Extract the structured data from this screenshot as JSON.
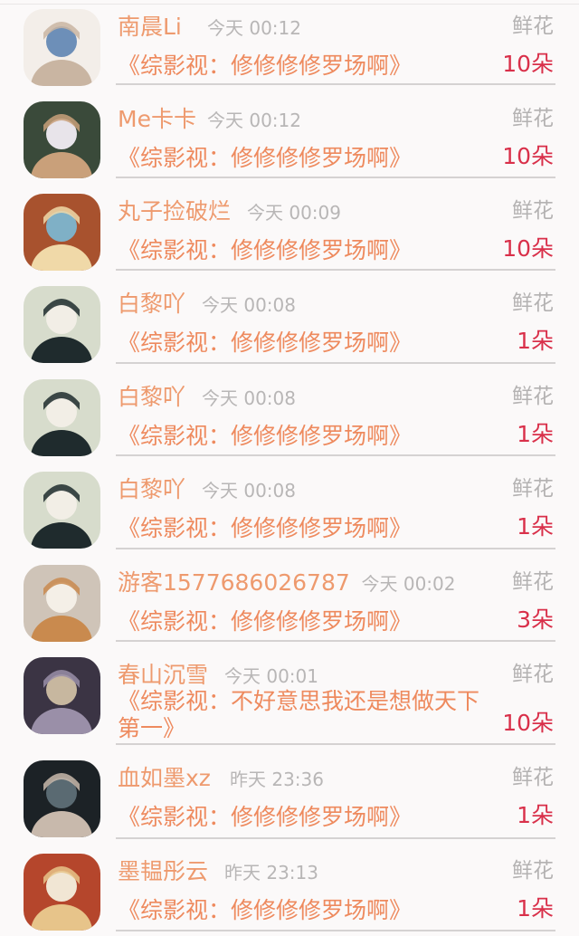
{
  "gifts": [
    {
      "name": "南晨Li",
      "time": "今天 00:12",
      "gift": "鲜花",
      "book": "《综影视：修修修修罗场啊》",
      "count": "10朵",
      "avatar_colors": [
        "#f3eee9",
        "#c9b5a2",
        "#6d8fb8"
      ]
    },
    {
      "name": "Me卡卡",
      "time": "今天 00:12",
      "gift": "鲜花",
      "book": "《综影视：修修修修罗场啊》",
      "count": "10朵",
      "avatar_colors": [
        "#3a4a3a",
        "#c9a07a",
        "#e8e4ea"
      ]
    },
    {
      "name": "丸子捡破烂",
      "time": "今天 00:09",
      "gift": "鲜花",
      "book": "《综影视：修修修修罗场啊》",
      "count": "10朵",
      "avatar_colors": [
        "#a8522e",
        "#f0d9a8",
        "#7fb0c6"
      ]
    },
    {
      "name": "白黎吖",
      "time": "今天 00:08",
      "gift": "鲜花",
      "book": "《综影视：修修修修罗场啊》",
      "count": "1朵",
      "avatar_colors": [
        "#d7dccc",
        "#1f2b2d",
        "#f2eee6"
      ]
    },
    {
      "name": "白黎吖",
      "time": "今天 00:08",
      "gift": "鲜花",
      "book": "《综影视：修修修修罗场啊》",
      "count": "1朵",
      "avatar_colors": [
        "#d7dccc",
        "#1f2b2d",
        "#f2eee6"
      ]
    },
    {
      "name": "白黎吖",
      "time": "今天 00:08",
      "gift": "鲜花",
      "book": "《综影视：修修修修罗场啊》",
      "count": "1朵",
      "avatar_colors": [
        "#d7dccc",
        "#1f2b2d",
        "#f2eee6"
      ]
    },
    {
      "name": "游客1577686026787",
      "time": "今天 00:02",
      "gift": "鲜花",
      "book": "《综影视：修修修修罗场啊》",
      "count": "3朵",
      "avatar_colors": [
        "#cfc4b8",
        "#c98a4e",
        "#f4efe7"
      ]
    },
    {
      "name": "春山沉雪",
      "time": "今天 00:01",
      "gift": "鲜花",
      "book": "《综影视：不好意思我还是想做天下第一》",
      "count": "10朵",
      "avatar_colors": [
        "#3b3444",
        "#9a8fa8",
        "#c7b79f"
      ]
    },
    {
      "name": "血如墨xz",
      "time": "昨天 23:36",
      "gift": "鲜花",
      "book": "《综影视：修修修修罗场啊》",
      "count": "1朵",
      "avatar_colors": [
        "#1c2226",
        "#c8b9ac",
        "#5a6a72"
      ]
    },
    {
      "name": "墨韫彤云",
      "time": "昨天 23:13",
      "gift": "鲜花",
      "book": "《综影视：修修修修罗场啊》",
      "count": "1朵",
      "avatar_colors": [
        "#b5462c",
        "#e7c48a",
        "#f1e6d4"
      ]
    }
  ]
}
